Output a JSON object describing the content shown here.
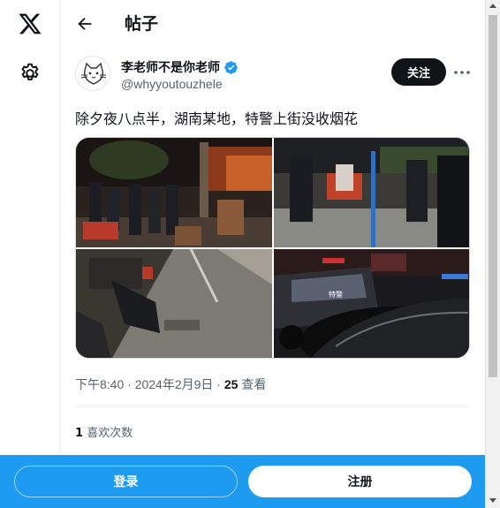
{
  "header": {
    "title": "帖子",
    "back_icon": "arrow-left-icon"
  },
  "sidebar": {
    "logo_icon": "x-logo-icon",
    "settings_icon": "gear-icon"
  },
  "tweet": {
    "author_name": "李老师不是你老师",
    "handle": "@whyyoutouzhele",
    "verified": true,
    "follow_label": "关注",
    "text": "除夕夜八点半，湖南某地，特警上街没收烟花",
    "timestamp": "下午8:40 · 2024年2月9日",
    "views_count": "25",
    "views_label": "查看",
    "likes_count": "1",
    "likes_label": "喜欢次数",
    "media_count": 4
  },
  "bottom_bar": {
    "login_label": "登录",
    "signup_label": "注册"
  },
  "colors": {
    "accent": "#1d9bf0",
    "text": "#0f1419",
    "secondary_text": "#536471",
    "verified": "#1d9bf0"
  }
}
